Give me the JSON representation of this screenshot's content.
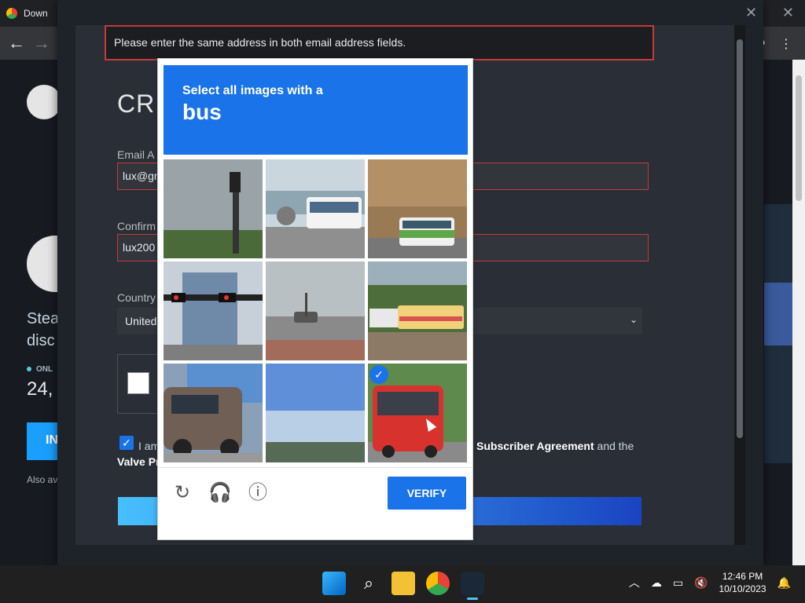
{
  "browser": {
    "tab_title": "Down",
    "back_icon": "back-arrow-icon",
    "forward_icon": "forward-arrow-icon"
  },
  "background_page": {
    "text_line": "Stea disc",
    "online_label": "ONL",
    "online_count": "24,",
    "install_label": "IN",
    "also_label": "Also av"
  },
  "signup": {
    "error_message": "Please enter the same address in both email address fields.",
    "title": "CR",
    "email_label": "Email A",
    "email_value": "lux@gn",
    "confirm_label": "Confirm",
    "confirm_value": "lux200",
    "country_label": "Country",
    "country_value": "United",
    "agree_prefix": "I am",
    "agree_link": "Subscriber Agreement",
    "agree_suffix": " and the",
    "agree_line2": "Valve Pr"
  },
  "captcha": {
    "instruction": "Select all images with a",
    "target": "bus",
    "verify_label": "VERIFY",
    "tiles": [
      {
        "name": "tile-1",
        "selected": false
      },
      {
        "name": "tile-2",
        "selected": false
      },
      {
        "name": "tile-3",
        "selected": false
      },
      {
        "name": "tile-4",
        "selected": false
      },
      {
        "name": "tile-5",
        "selected": false
      },
      {
        "name": "tile-6",
        "selected": false
      },
      {
        "name": "tile-7",
        "selected": false
      },
      {
        "name": "tile-8",
        "selected": false
      },
      {
        "name": "tile-9",
        "selected": true
      }
    ],
    "colors": {
      "accent": "#1a73e8"
    }
  },
  "taskbar": {
    "time": "12:46 PM",
    "date": "10/10/2023"
  }
}
